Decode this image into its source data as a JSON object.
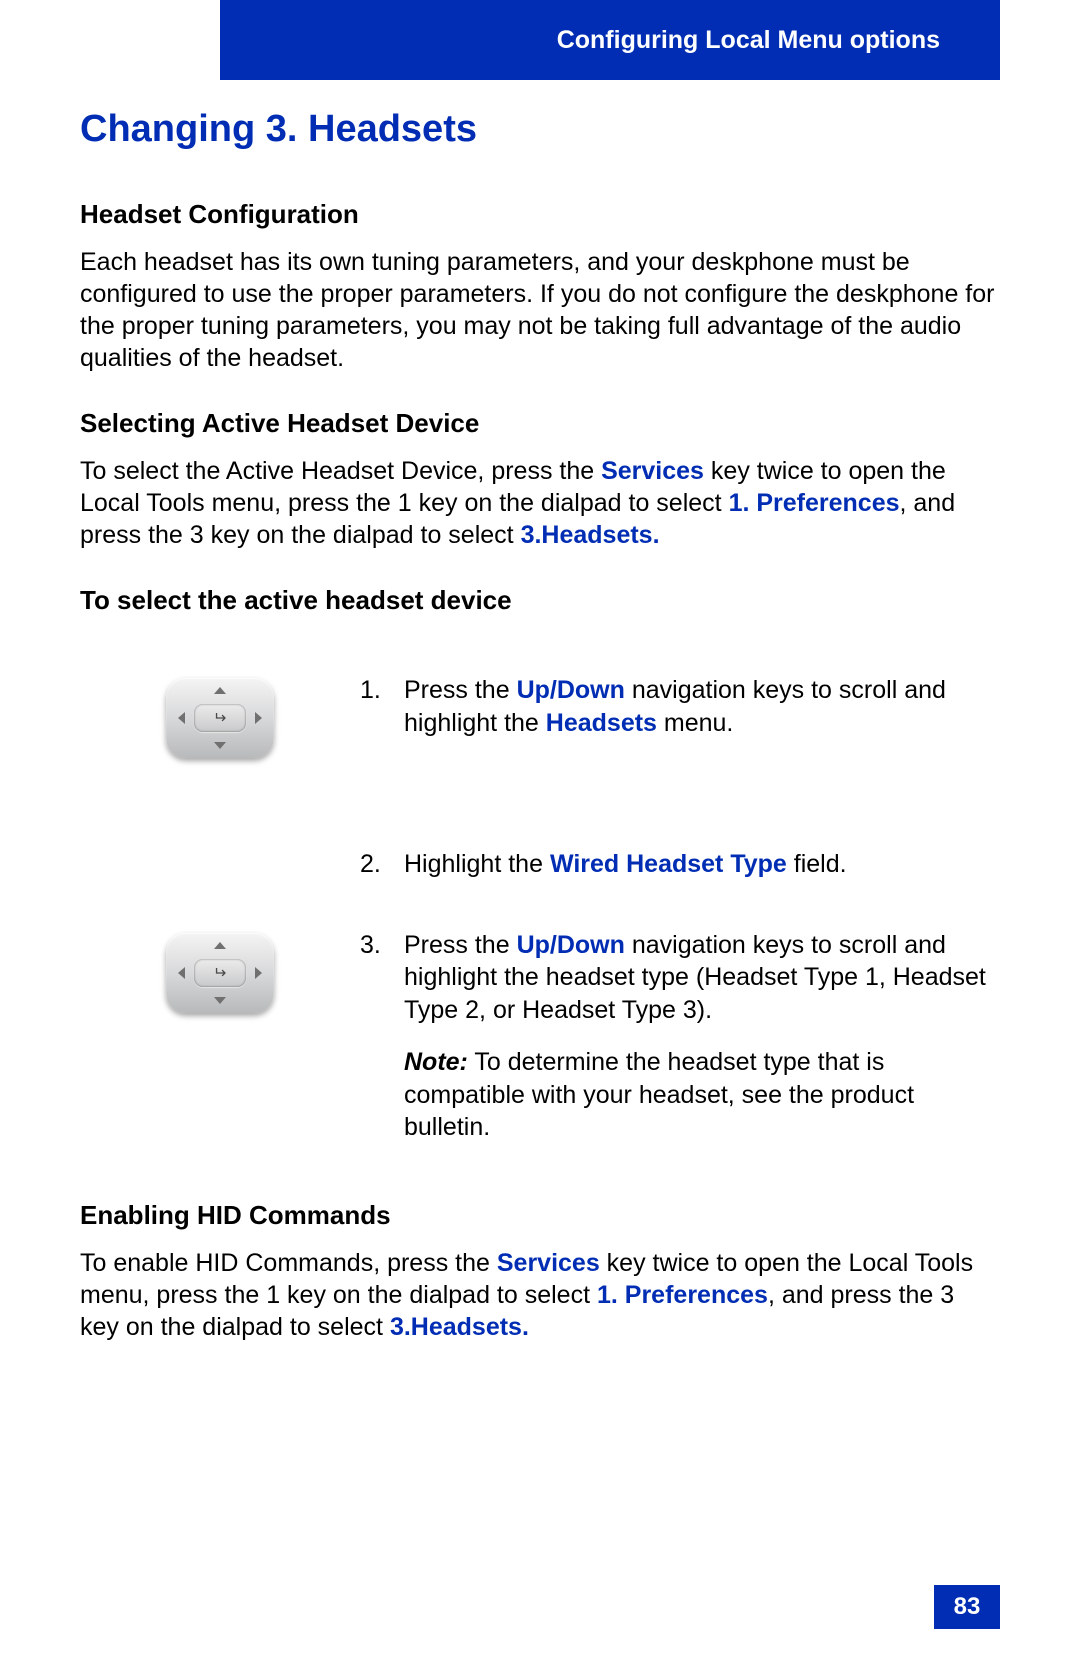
{
  "header": {
    "breadcrumb": "Configuring Local Menu options"
  },
  "title": "Changing 3. Headsets",
  "sections": {
    "config": {
      "heading": "Headset Configuration",
      "body": "Each headset has its own tuning parameters, and your deskphone must be configured to use the proper parameters. If you do not configure the deskphone for the proper tuning parameters, you may not be taking full advantage of the audio qualities of the headset."
    },
    "selecting": {
      "heading": "Selecting Active Headset Device",
      "body_pre": "To select the Active Headset Device, press the ",
      "services": "Services",
      "body_mid1": " key twice to open the Local Tools menu, press the 1 key on the dialpad to select ",
      "prefs": "1. Preferences",
      "body_mid2": ", and press the 3 key on the dialpad to select ",
      "headsets": "3.Headsets."
    },
    "to_select": {
      "heading": "To select the active headset device"
    },
    "steps": {
      "s1": {
        "num": "1.",
        "pre": "Press the ",
        "key": "Up/Down",
        "mid": " navigation keys to scroll and highlight the ",
        "menu": "Headsets",
        "post": " menu."
      },
      "s2": {
        "num": "2.",
        "pre": "Highlight the ",
        "key": "Wired Headset Type",
        "post": " field."
      },
      "s3": {
        "num": "3.",
        "pre": "Press the ",
        "key": "Up/Down",
        "post": " navigation keys to scroll and highlight the headset type (Headset Type 1, Headset Type 2, or Headset Type 3).",
        "note_label": "Note:",
        "note_body": " To determine the headset type that is compatible with your headset, see the product bulletin."
      }
    },
    "hid": {
      "heading": "Enabling HID Commands",
      "body_pre": "To enable HID Commands, press the ",
      "services": "Services",
      "body_mid1": " key twice to open the Local Tools menu, press the 1 key on the dialpad to select ",
      "prefs": "1. Preferences",
      "body_mid2": ", and press the 3 key on the dialpad to select ",
      "headsets": "3.Headsets."
    }
  },
  "page_number": "83"
}
